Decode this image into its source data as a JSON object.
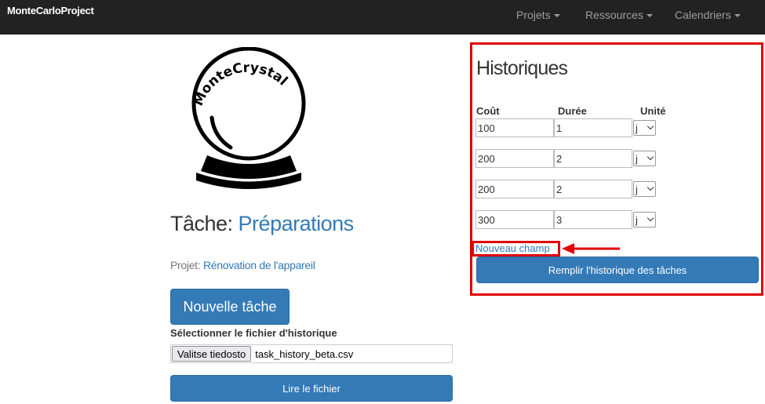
{
  "navbar": {
    "brand": "MonteCarloProject",
    "items": [
      {
        "label": "Projets"
      },
      {
        "label": "Ressources"
      },
      {
        "label": "Calendriers"
      }
    ]
  },
  "logo": {
    "text": "MonteCrystal"
  },
  "task": {
    "label": "Tâche: ",
    "name": "Préparations",
    "project_label": "Projet: ",
    "project_name": "Rénovation de l'appareil",
    "new_task_button": "Nouvelle tâche",
    "file_section_label": "Sélectionner le fichier d'historique",
    "file_button": "Valitse tiedosto",
    "file_name": "task_history_beta.csv",
    "read_button": "Lire le fichier"
  },
  "history": {
    "title": "Historiques",
    "columns": [
      "Coût",
      "Durée",
      "Unité"
    ],
    "rows": [
      {
        "cout": "100",
        "duree": "1",
        "unite": "j"
      },
      {
        "cout": "200",
        "duree": "2",
        "unite": "j"
      },
      {
        "cout": "200",
        "duree": "2",
        "unite": "j"
      },
      {
        "cout": "300",
        "duree": "3",
        "unite": "j"
      }
    ],
    "new_field_link": "Nouveau champ",
    "fill_button": "Remplir l'historique des tâches"
  },
  "colors": {
    "navbar_bg": "#222222",
    "primary": "#337ab7",
    "annotation_red": "#e00000"
  }
}
